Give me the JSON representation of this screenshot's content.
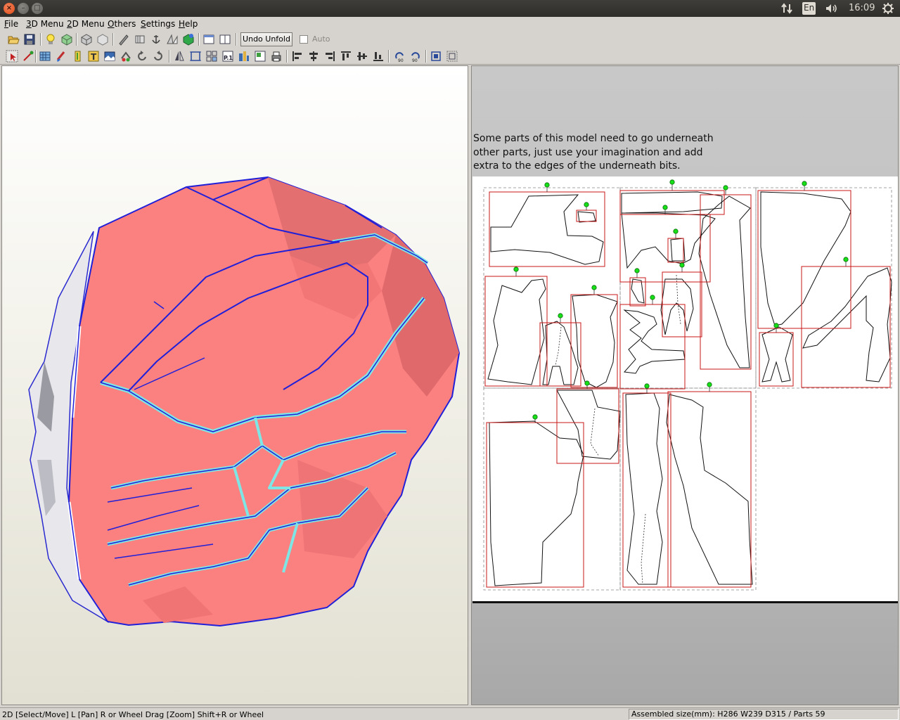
{
  "system_tray": {
    "sort_icon": "sort-arrows-icon",
    "keyboard_layout": "En",
    "volume_icon": "volume-icon",
    "clock": "16:09",
    "power_icon": "gear-power-icon"
  },
  "window_controls": {
    "close_glyph": "×",
    "min_glyph": "–",
    "max_glyph": "□"
  },
  "menubar": {
    "items": [
      {
        "label": "File",
        "accel": "F",
        "rest": "ile"
      },
      {
        "label": "3D Menu",
        "accel": "3",
        "rest": "D Menu"
      },
      {
        "label": "2D Menu",
        "accel": "2",
        "rest": "D Menu"
      },
      {
        "label": "Others",
        "accel": "O",
        "rest": "thers"
      },
      {
        "label": "Settings",
        "accel": "S",
        "rest": "ettings"
      },
      {
        "label": "Help",
        "accel": "H",
        "rest": "elp"
      }
    ]
  },
  "toolbar1": {
    "undo_unfold_label": "Undo Unfold",
    "auto_label": "Auto",
    "auto_checked": false
  },
  "pane2d": {
    "note_line1": "Some parts of this model need to go underneath",
    "note_line2": "other parts, just use your imagination and add",
    "note_line3": "extra to the edges of the underneath bits."
  },
  "statusbar": {
    "left": "2D [Select/Move] L [Pan] R or Wheel Drag [Zoom] Shift+R or Wheel",
    "right": "Assembled size(mm): H286 W239 D315 / Parts 59"
  },
  "colors": {
    "model_face": "#fb8080",
    "model_edge": "#2020d8",
    "seam": "#7fe6e6",
    "part_box": "#c81818",
    "pin": "#18e018",
    "accent_close": "#e95420"
  }
}
